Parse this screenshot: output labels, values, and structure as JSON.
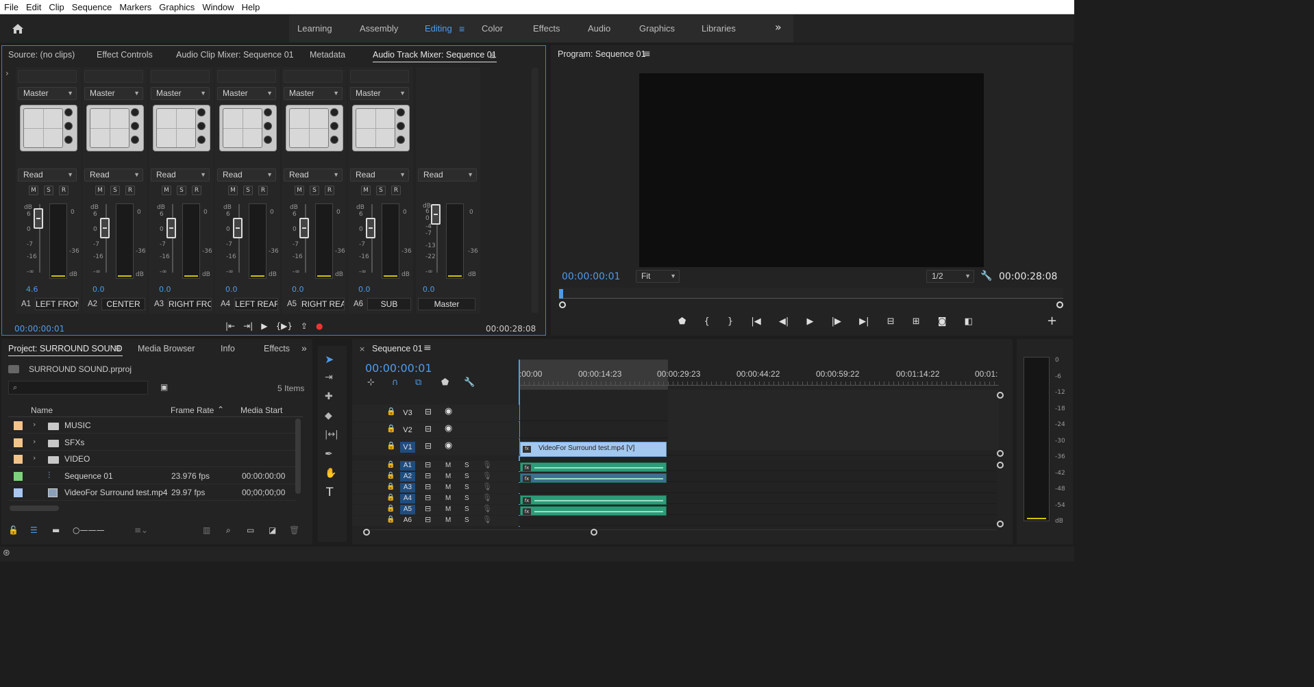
{
  "menu": [
    "File",
    "Edit",
    "Clip",
    "Sequence",
    "Markers",
    "Graphics",
    "Window",
    "Help"
  ],
  "workspaces": {
    "tabs": [
      "Learning",
      "Assembly",
      "Editing",
      "Color",
      "Effects",
      "Audio",
      "Graphics",
      "Libraries"
    ],
    "active": "Editing",
    "more": "»"
  },
  "source_panel": {
    "tabs": [
      "Source: (no clips)",
      "Effect Controls",
      "Audio Clip Mixer: Sequence 01",
      "Metadata",
      "Audio Track Mixer: Sequence 01"
    ],
    "active": "Audio Track Mixer: Sequence 01",
    "expand_arrow": "›"
  },
  "mixer": {
    "tracks": [
      {
        "id": "A1",
        "name": "LEFT FRON",
        "send": "Master",
        "mode": "Read",
        "volume": "4.6",
        "m": "M",
        "s": "S",
        "r": "R"
      },
      {
        "id": "A2",
        "name": "CENTER",
        "send": "Master",
        "mode": "Read",
        "volume": "0.0",
        "m": "M",
        "s": "S",
        "r": "R"
      },
      {
        "id": "A3",
        "name": "RIGHT FRC",
        "send": "Master",
        "mode": "Read",
        "volume": "0.0",
        "m": "M",
        "s": "S",
        "r": "R"
      },
      {
        "id": "A4",
        "name": "LEFT REAR",
        "send": "Master",
        "mode": "Read",
        "volume": "0.0",
        "m": "M",
        "s": "S",
        "r": "R"
      },
      {
        "id": "A5",
        "name": "RIGHT REA",
        "send": "Master",
        "mode": "Read",
        "volume": "0.0",
        "m": "M",
        "s": "S",
        "r": "R"
      },
      {
        "id": "A6",
        "name": "SUB",
        "send": "Master",
        "mode": "Read",
        "volume": "0.0",
        "m": "M",
        "s": "S",
        "r": "R"
      }
    ],
    "master": {
      "name": "Master",
      "mode": "Read",
      "volume": "0.0"
    },
    "db_scale": [
      "dB",
      "6",
      "0",
      "-7",
      "-16",
      "-∞"
    ],
    "meter_scale": [
      "0",
      "-36",
      "dB"
    ],
    "master_scale": [
      "dB",
      "6",
      "0",
      "-4",
      "-7",
      "-13",
      "-22",
      "-∞"
    ],
    "timecode_in": "00:00:00:01",
    "timecode_out": "00:00:28:08"
  },
  "program": {
    "title": "Program: Sequence 01",
    "timecode": "00:00:00:01",
    "fit": "Fit",
    "resolution": "1/2",
    "duration": "00:00:28:08"
  },
  "project": {
    "tabs": [
      "Project: SURROUND SOUND",
      "Media Browser",
      "Info",
      "Effects"
    ],
    "active": "Project: SURROUND SOUND",
    "file": "SURROUND SOUND.prproj",
    "search_placeholder": "",
    "count": "5 Items",
    "columns": [
      "Name",
      "Frame Rate",
      "Media Start"
    ],
    "rows": [
      {
        "name": "MUSIC",
        "type": "folder",
        "color": "#f3c48a",
        "rate": "",
        "start": ""
      },
      {
        "name": "SFXs",
        "type": "folder",
        "color": "#f3c48a",
        "rate": "",
        "start": ""
      },
      {
        "name": "VIDEO",
        "type": "folder",
        "color": "#f3c48a",
        "rate": "",
        "start": ""
      },
      {
        "name": "Sequence 01",
        "type": "sequence",
        "color": "#7fd07e",
        "rate": "23.976 fps",
        "start": "00:00:00:00"
      },
      {
        "name": "VideoFor Surround test.mp4",
        "type": "clip",
        "color": "#a8c6f0",
        "rate": "29.97 fps",
        "start": "00;00;00;00"
      }
    ]
  },
  "timeline": {
    "title": "Sequence 01",
    "timecode": "00:00:00:01",
    "ruler": [
      ":00:00",
      "00:00:14:23",
      "00:00:29:23",
      "00:00:44:22",
      "00:00:59:22",
      "00:01:14:22",
      "00:01:"
    ],
    "video_tracks": [
      "V3",
      "V2",
      "V1"
    ],
    "audio_tracks": [
      "A1",
      "A2",
      "A3",
      "A4",
      "A5",
      "A6"
    ],
    "clip_name": "VideoFor Surround test.mp4 [V]",
    "fx": "fx",
    "m": "M",
    "s": "S"
  },
  "master_meter": {
    "scale": [
      "0",
      "-6",
      "-12",
      "-18",
      "-24",
      "-30",
      "-36",
      "-42",
      "-48",
      "-54",
      "dB"
    ]
  }
}
